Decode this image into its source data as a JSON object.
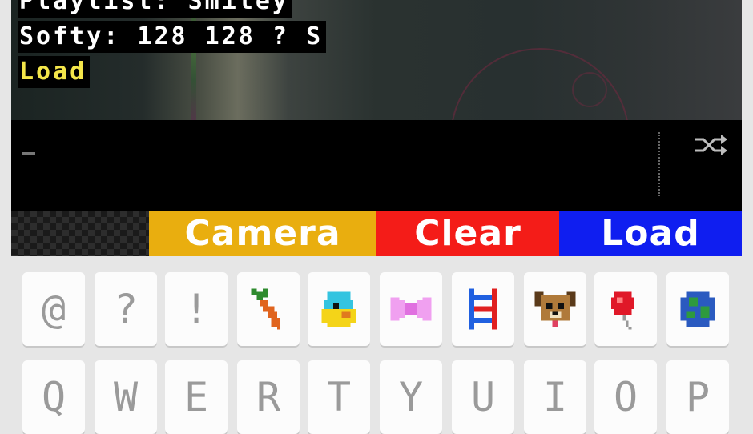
{
  "overlay": {
    "line1": "Playlist: Smiley",
    "line2": "Softy: 128 128 ? S",
    "line3": "Load"
  },
  "terminal": {
    "cursor": "_"
  },
  "icons": {
    "shuffle": "shuffle-icon"
  },
  "actions": {
    "camera": "Camera",
    "clear": "Clear",
    "load": "Load"
  },
  "colors": {
    "camera": "#e9ae0f",
    "clear": "#f41c18",
    "load": "#0f1ef0",
    "overlay_highlight": "#f4e64a"
  },
  "keyboard": {
    "row1": [
      {
        "label": "@"
      },
      {
        "label": "?"
      },
      {
        "label": "!"
      },
      {
        "icon": "carrot-icon"
      },
      {
        "icon": "bird-icon"
      },
      {
        "icon": "bow-icon"
      },
      {
        "icon": "dna-icon"
      },
      {
        "icon": "dog-icon"
      },
      {
        "icon": "balloon-icon"
      },
      {
        "icon": "globe-icon"
      }
    ],
    "row2": [
      {
        "label": "Q"
      },
      {
        "label": "W"
      },
      {
        "label": "E"
      },
      {
        "label": "R"
      },
      {
        "label": "T"
      },
      {
        "label": "Y"
      },
      {
        "label": "U"
      },
      {
        "label": "I"
      },
      {
        "label": "O"
      },
      {
        "label": "P"
      }
    ]
  }
}
